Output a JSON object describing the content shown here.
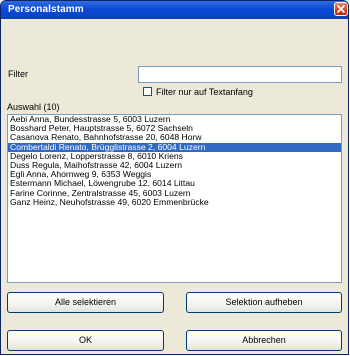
{
  "window": {
    "title": "Personalstamm"
  },
  "filter": {
    "label": "Filter",
    "value": "",
    "checkbox_label": "Filter nur auf Textanfang",
    "checkbox_checked": false
  },
  "list": {
    "label": "Auswahl (10)",
    "items": [
      "Aebi Anna, Bundesstrasse 5, 6003 Luzern",
      "Bosshard Peter, Hauptstrasse 5, 6072 Sachseln",
      "Casanova Renato, Bahnhofstrasse 20, 6048 Horw",
      "Combertaldi Renato, Brügglistrasse 2, 6004 Luzern",
      "Degelo Lorenz, Lopperstrasse 8, 6010 Kriens",
      "Duss Regula, Maihofstrasse 42, 6004 Luzern",
      "Egli Anna, Ahornweg 9, 6353 Weggis",
      "Estermann Michael, Löwengrube 12, 6014 Littau",
      "Farine Corinne, Zentralstrasse 45, 6003 Luzern",
      "Ganz Heinz, Neuhofstrasse 49, 6020 Emmenbrücke"
    ],
    "selected_index": 3
  },
  "buttons": {
    "select_all": "Alle selektieren",
    "clear_selection": "Selektion aufheben",
    "ok": "OK",
    "cancel": "Abbrechen"
  },
  "colors": {
    "titlebar": "#0b4ad6",
    "dialog_bg": "#ece9d8",
    "selection": "#316ac5"
  }
}
